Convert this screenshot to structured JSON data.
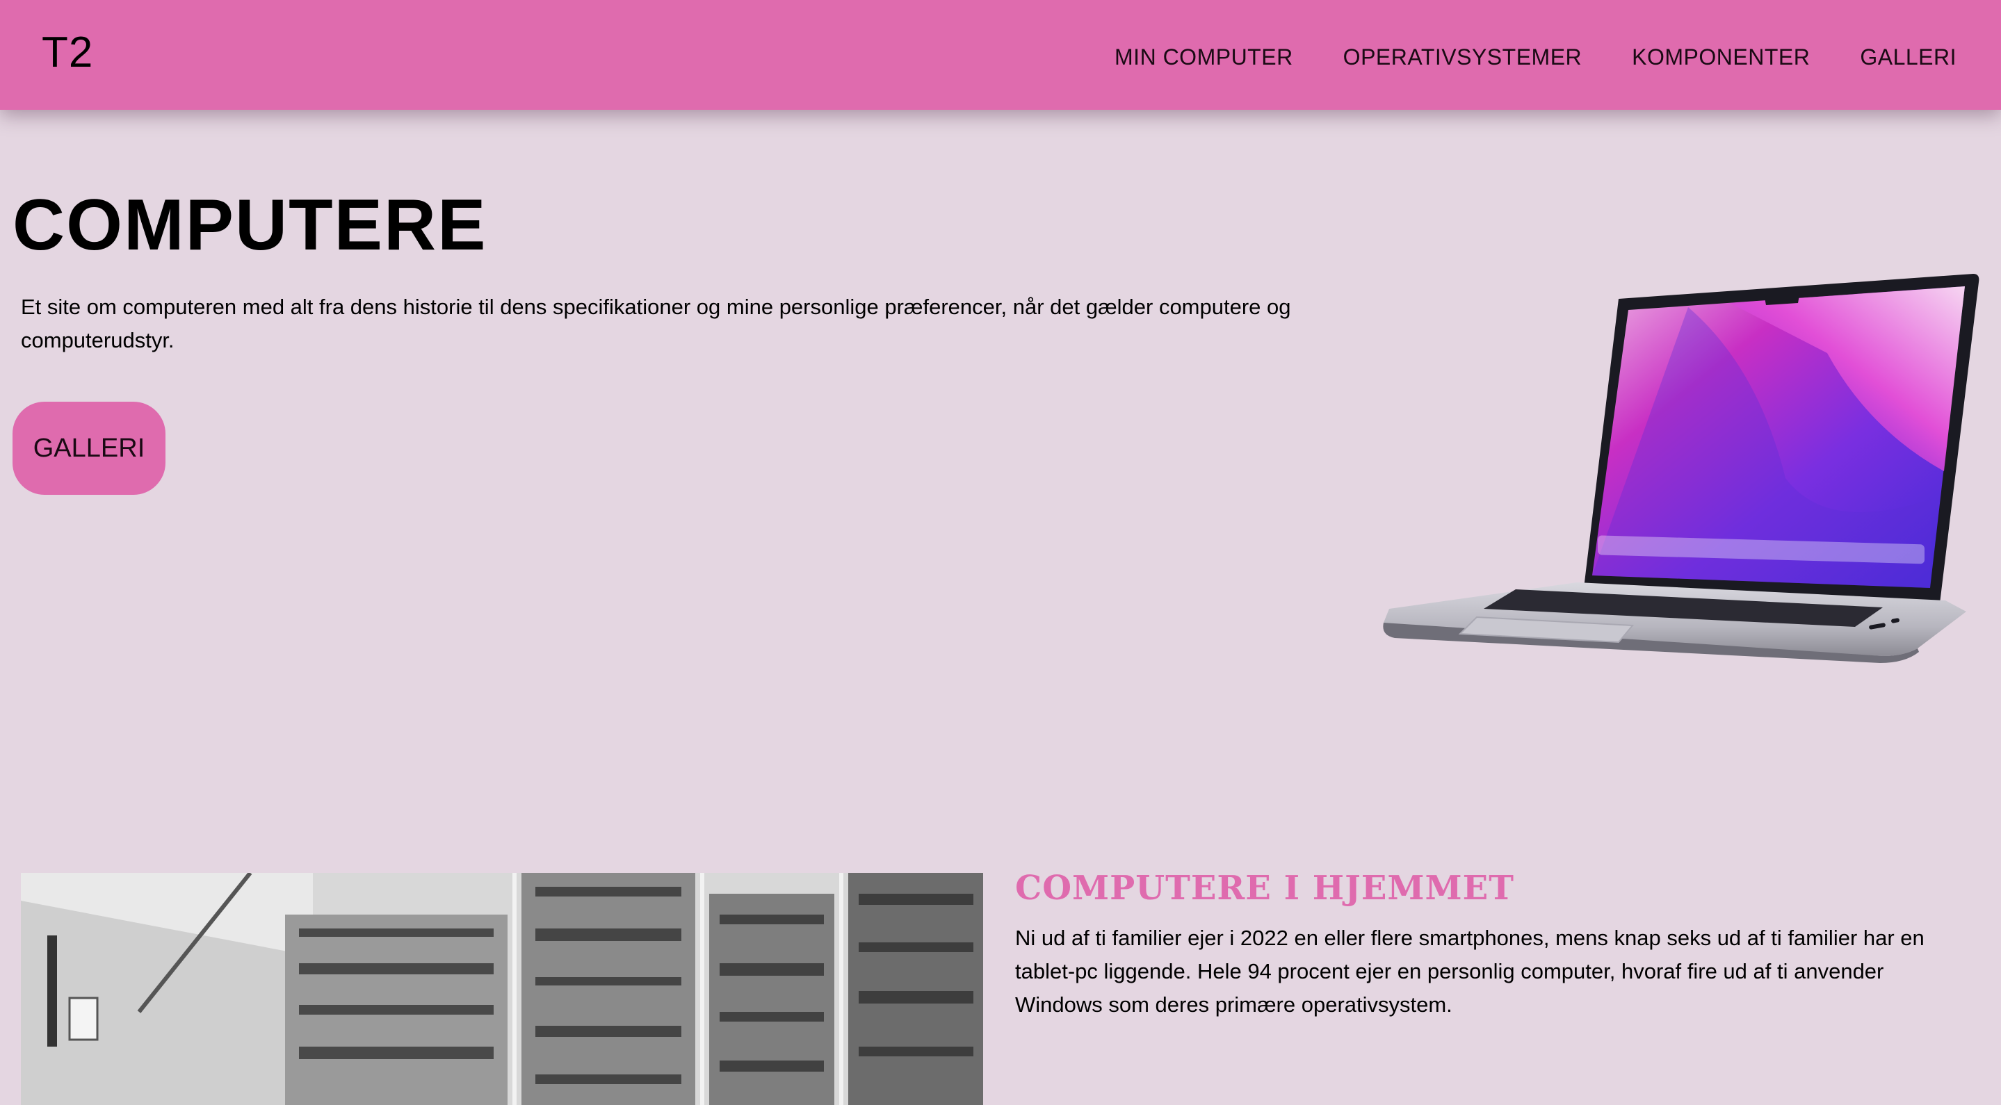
{
  "header": {
    "logo": "T2",
    "nav": [
      {
        "label": "MIN COMPUTER"
      },
      {
        "label": "OPERATIVSYSTEMER"
      },
      {
        "label": "KOMPONENTER"
      },
      {
        "label": "GALLERI"
      }
    ]
  },
  "hero": {
    "title": "COMPUTERE",
    "text": "Et site om computeren med alt fra dens historie til dens specifikationer og mine personlige præferencer, når det gælder computere og computerudstyr.",
    "button_label": "GALLERI"
  },
  "section_home": {
    "title": "COMPUTERE I HJEMMET",
    "text": "Ni ud af ti familier ejer i 2022 en eller flere smartphones, mens knap seks ud af ti familier har en tablet-pc liggende. Hele 94 procent ejer en personlig computer, hvoraf fire ud af ti anvender Windows som deres primære operativsystem."
  },
  "colors": {
    "accent": "#df6bae",
    "background": "#e4d6e1",
    "text": "#000000"
  }
}
